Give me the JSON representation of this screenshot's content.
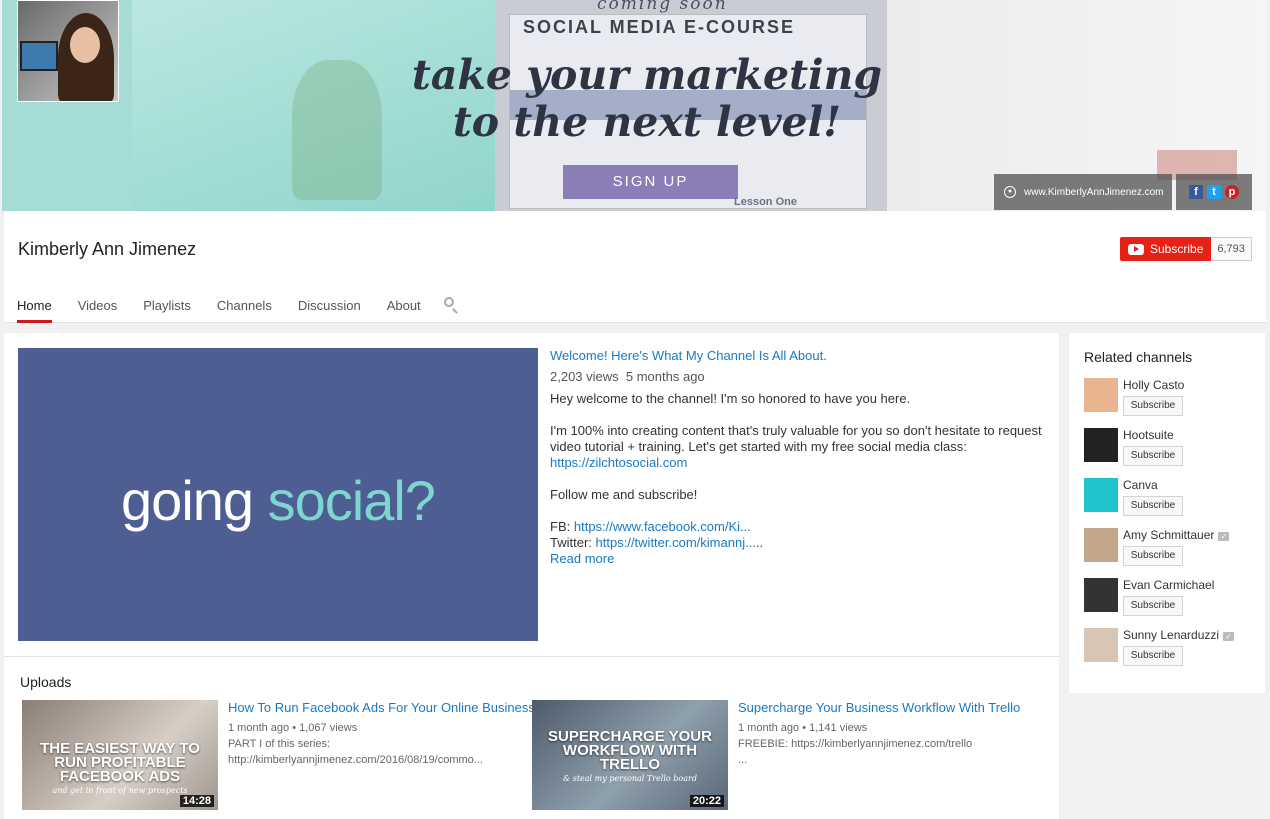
{
  "banner": {
    "coming_soon": "coming soon",
    "course": "SOCIAL MEDIA E-COURSE",
    "headline_line1": "take your marketing",
    "headline_line2": "to the next level!",
    "signup": "SIGN UP",
    "lesson": "Lesson One",
    "website": "www.KimberlyAnnJimenez.com",
    "social_icons": [
      "facebook-icon",
      "twitter-icon",
      "pinterest-icon"
    ]
  },
  "channel": {
    "name": "Kimberly Ann Jimenez",
    "subscribe_label": "Subscribe",
    "subscriber_count": "6,793"
  },
  "tabs": [
    "Home",
    "Videos",
    "Playlists",
    "Channels",
    "Discussion",
    "About"
  ],
  "featured": {
    "thumb_text_1": "going",
    "thumb_text_2": "social?",
    "title": "Welcome! Here's What My Channel Is All About.",
    "views": "2,203 views",
    "age": "5 months ago",
    "desc1": "Hey welcome to the channel! I'm so honored to have you here.",
    "desc2": "I'm 100% into creating content that's truly valuable for you so don't hesitate to request video tutorial + training. Let's get started with my free social media class:",
    "desc2_link": "https://zilchtosocial.com",
    "desc3": "Follow me and subscribe!",
    "fb_label": "FB:",
    "fb_link": "https://www.facebook.com/Ki...",
    "tw_label": "Twitter:",
    "tw_link": "https://twitter.com/kimannj...",
    "tw_suffix": "..",
    "read_more": "Read more"
  },
  "uploads": {
    "title": "Uploads",
    "items": [
      {
        "thumb_big": "THE EASIEST WAY TO RUN PROFITABLE FACEBOOK ADS",
        "thumb_small": "and get in front of new prospects",
        "duration": "14:28",
        "title": "How To Run Facebook Ads For Your Online Business",
        "age": "1 month ago",
        "views": "1,067 views",
        "desc1": "PART I of this series:",
        "desc2": "http://kimberlyannjimenez.com/2016/08/19/commo..."
      },
      {
        "thumb_big": "SUPERCHARGE YOUR WORKFLOW WITH TRELLO",
        "thumb_small": "& steal my personal Trello board",
        "duration": "20:22",
        "title": "Supercharge Your Business Workflow With Trello",
        "age": "1 month ago",
        "views": "1,141 views",
        "desc1": "FREEBIE: https://kimberlyannjimenez.com/trello",
        "desc2": "..."
      }
    ]
  },
  "related": {
    "title": "Related channels",
    "subscribe_label": "Subscribe",
    "channels": [
      {
        "name": "Holly Casto",
        "verified": false,
        "color": "#e8b48f"
      },
      {
        "name": "Hootsuite",
        "verified": false,
        "color": "#222222"
      },
      {
        "name": "Canva",
        "verified": false,
        "color": "#20c4cb"
      },
      {
        "name": "Amy Schmittauer",
        "verified": true,
        "color": "#c4a68a"
      },
      {
        "name": "Evan Carmichael",
        "verified": false,
        "color": "#333333"
      },
      {
        "name": "Sunny Lenarduzzi",
        "verified": true,
        "color": "#d9c5b4"
      }
    ]
  },
  "colors": {
    "accent_red": "#e62117",
    "link_blue": "#167ac6",
    "signup_purple": "#8b7db5",
    "featured_bg": "#4e5d92"
  }
}
